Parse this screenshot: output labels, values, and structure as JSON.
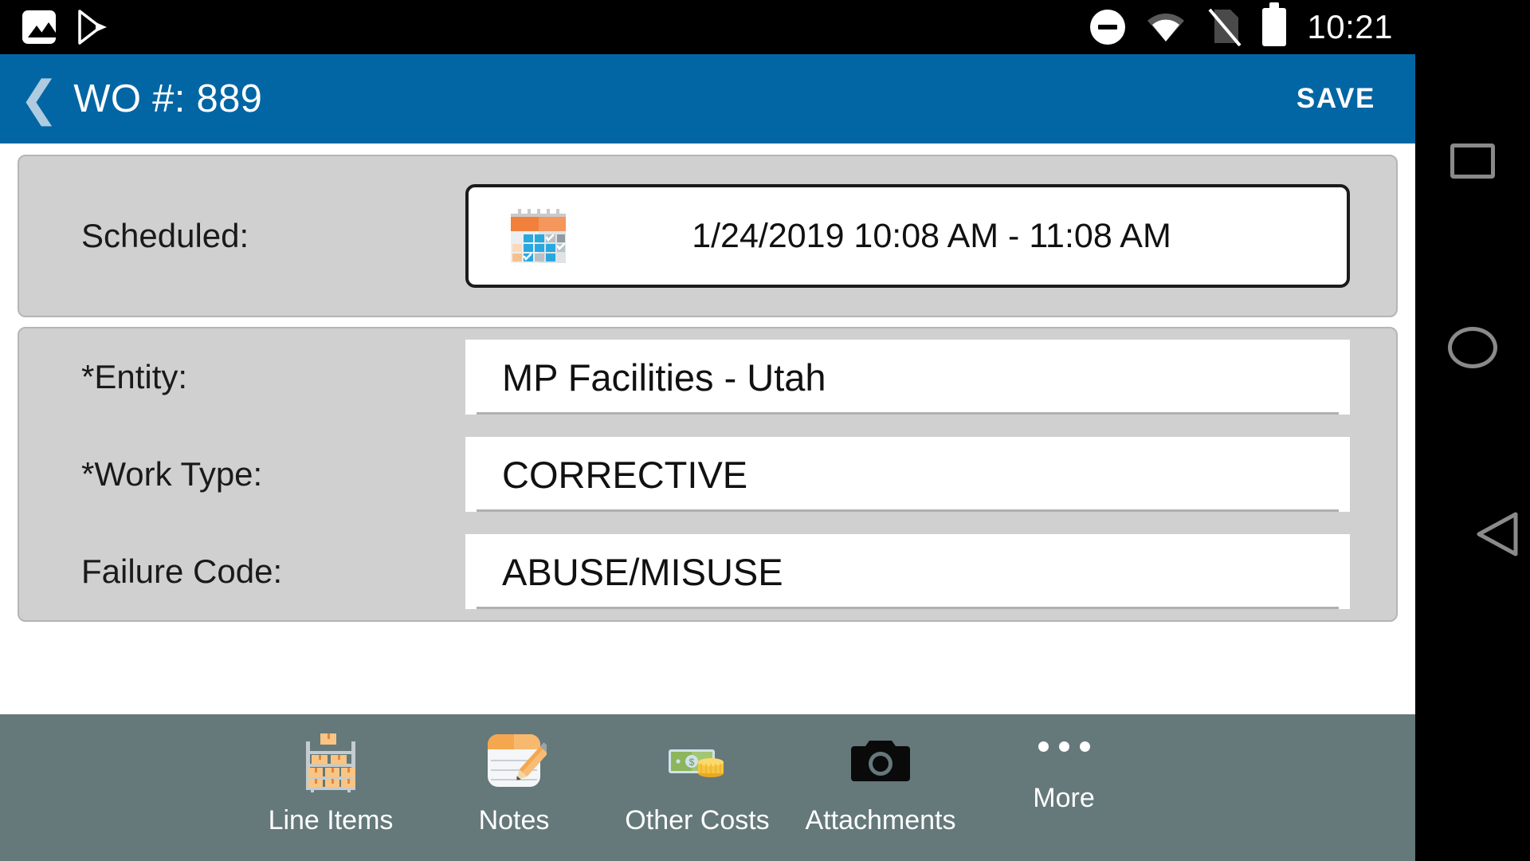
{
  "statusbar": {
    "time": "10:21",
    "icons": [
      {
        "name": "photo-icon"
      },
      {
        "name": "play-store-icon"
      },
      {
        "name": "do-not-disturb-icon"
      },
      {
        "name": "wifi-icon"
      },
      {
        "name": "no-sim-icon"
      },
      {
        "name": "battery-full-icon"
      }
    ]
  },
  "appbar": {
    "back_icon": "❮",
    "title": "WO #: 889",
    "save_label": "SAVE",
    "background": "#0366a4"
  },
  "form": {
    "scheduled": {
      "label": "Scheduled:",
      "value": "1/24/2019 10:08 AM - 11:08 AM",
      "icon": "calendar-icon"
    },
    "fields": [
      {
        "label": "*Entity:",
        "value": "MP Facilities - Utah"
      },
      {
        "label": "*Work Type:",
        "value": "CORRECTIVE"
      },
      {
        "label": "Failure Code:",
        "value": "ABUSE/MISUSE"
      }
    ]
  },
  "bottombar": {
    "background": "#65787a",
    "items": [
      {
        "label": "Line Items",
        "icon": "shelf-boxes-icon"
      },
      {
        "label": "Notes",
        "icon": "notepad-pencil-icon"
      },
      {
        "label": "Other Costs",
        "icon": "money-icon"
      },
      {
        "label": "Attachments",
        "icon": "camera-icon"
      },
      {
        "label": "More",
        "icon": "ellipsis-icon"
      }
    ]
  },
  "navbar": {
    "buttons": [
      {
        "name": "recent-apps-button",
        "icon": "square-icon"
      },
      {
        "name": "home-button",
        "icon": "circle-icon"
      },
      {
        "name": "back-button",
        "icon": "triangle-left-icon"
      }
    ]
  }
}
